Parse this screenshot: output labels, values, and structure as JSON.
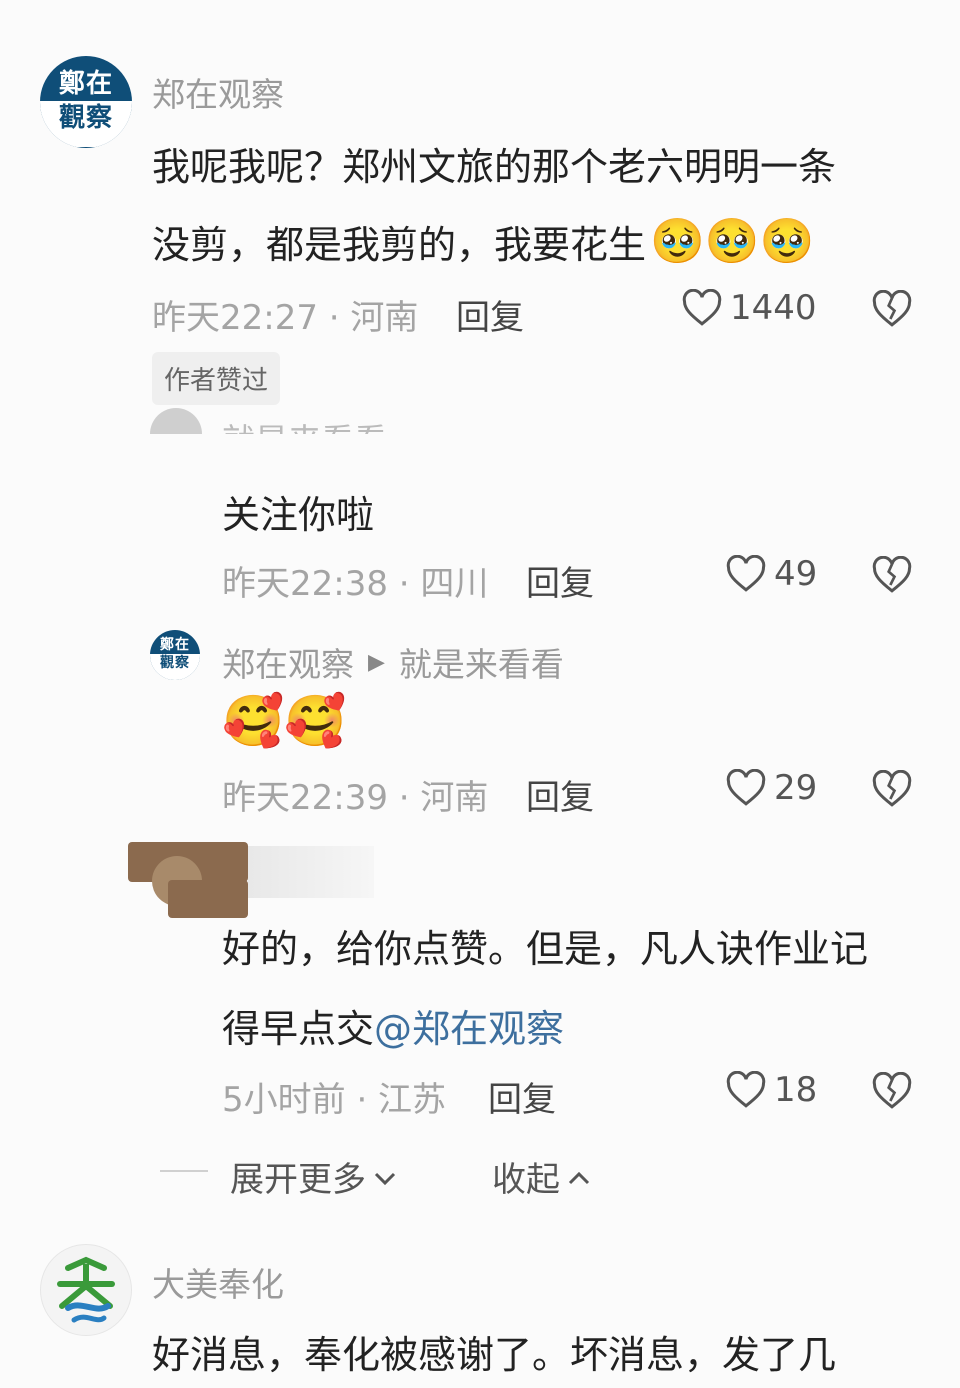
{
  "comments": [
    {
      "author": "郑在观察",
      "avatar_text_top": "鄭在",
      "avatar_text_bottom": "觀察",
      "text_line1": "我呢我呢？郑州文旅的那个老六明明一条",
      "text_line2": "没剪，都是我剪的，我要花生",
      "emojis": "🥹🥹🥹",
      "meta": "昨天22:27 · 河南",
      "reply_label": "回复",
      "likes": "1440",
      "badge": "作者赞过"
    },
    {
      "author": "就是来看看",
      "text": "关注你啦",
      "meta": "昨天22:38 · 四川",
      "reply_label": "回复",
      "likes": "49"
    },
    {
      "author": "郑在观察",
      "reply_to": "就是来看看",
      "avatar_text_top": "鄭在",
      "avatar_text_bottom": "觀察",
      "emojis": "🥰🥰",
      "meta": "昨天22:39 · 河南",
      "reply_label": "回复",
      "likes": "29"
    },
    {
      "text_line1": "好的，给你点赞。但是，凡人诀作业记",
      "text_line2_prefix": "得早点交",
      "mention": "@郑在观察",
      "meta": "5小时前 · 江苏",
      "reply_label": "回复",
      "likes": "18"
    },
    {
      "author": "大美奉化",
      "text_line1": "好消息，奉化被感谢了。坏消息，发了几"
    }
  ],
  "thread_controls": {
    "expand_label": "展开更多",
    "collapse_label": "收起"
  },
  "colors": {
    "name_gray": "#9a9a9a",
    "mention_blue": "#3d6f9e",
    "logo_blue": "#0f4e78",
    "fenghua_green": "#3a9a3a"
  },
  "icons": [
    "heart-outline-icon",
    "dislike-broken-heart-icon",
    "chevron-down-icon",
    "chevron-up-icon",
    "reply-arrow-icon"
  ]
}
